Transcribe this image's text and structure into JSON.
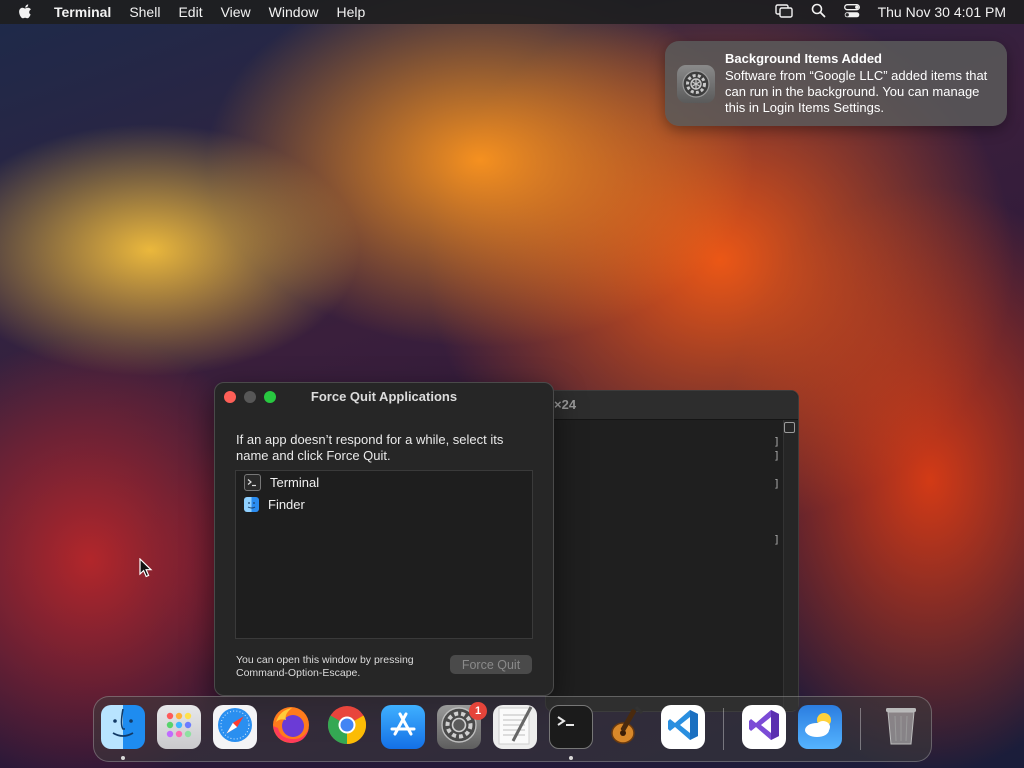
{
  "menubar": {
    "apple_icon": "apple-logo-icon",
    "app_name": "Terminal",
    "menus": [
      "Shell",
      "Edit",
      "View",
      "Window",
      "Help"
    ],
    "status_icons": [
      "screen-mirroring-icon",
      "spotlight-search-icon",
      "control-center-icon"
    ],
    "clock": "Thu Nov 30  4:01 PM"
  },
  "notification": {
    "icon": "system-settings-gear-icon",
    "title": "Background Items Added",
    "body": "Software from “Google LLC” added items that can run in the background. You can manage this in Login Items Settings."
  },
  "terminal_window": {
    "title_fragment": "×24",
    "bracket": "]"
  },
  "force_quit": {
    "title": "Force Quit Applications",
    "instructions": "If an app doesn’t respond for a while, select its name and click Force Quit.",
    "apps": [
      {
        "name": "Terminal",
        "icon": "terminal-icon"
      },
      {
        "name": "Finder",
        "icon": "finder-icon"
      }
    ],
    "hint": "You can open this window by pressing Command-Option-Escape.",
    "button": "Force Quit",
    "button_enabled": false
  },
  "dock": {
    "items": [
      {
        "name": "Finder",
        "icon": "finder-icon",
        "running": true
      },
      {
        "name": "Launchpad",
        "icon": "launchpad-icon",
        "running": false
      },
      {
        "name": "Safari",
        "icon": "safari-icon",
        "running": false
      },
      {
        "name": "Firefox",
        "icon": "firefox-icon",
        "running": false
      },
      {
        "name": "Google Chrome",
        "icon": "chrome-icon",
        "running": false
      },
      {
        "name": "App Store",
        "icon": "app-store-icon",
        "running": false
      },
      {
        "name": "System Settings",
        "icon": "system-settings-icon",
        "running": false,
        "badge": "1"
      },
      {
        "name": "TextEdit",
        "icon": "textedit-icon",
        "running": false
      },
      {
        "name": "Terminal",
        "icon": "terminal-icon",
        "running": true
      },
      {
        "name": "GarageBand",
        "icon": "garageband-icon",
        "running": false
      },
      {
        "name": "Visual Studio Code",
        "icon": "vscode-icon",
        "running": false
      },
      {
        "name": "Visual Studio",
        "icon": "visual-studio-icon",
        "running": false
      },
      {
        "name": "Weather",
        "icon": "weather-icon",
        "running": false
      },
      {
        "name": "Trash",
        "icon": "trash-icon",
        "running": false
      }
    ]
  }
}
